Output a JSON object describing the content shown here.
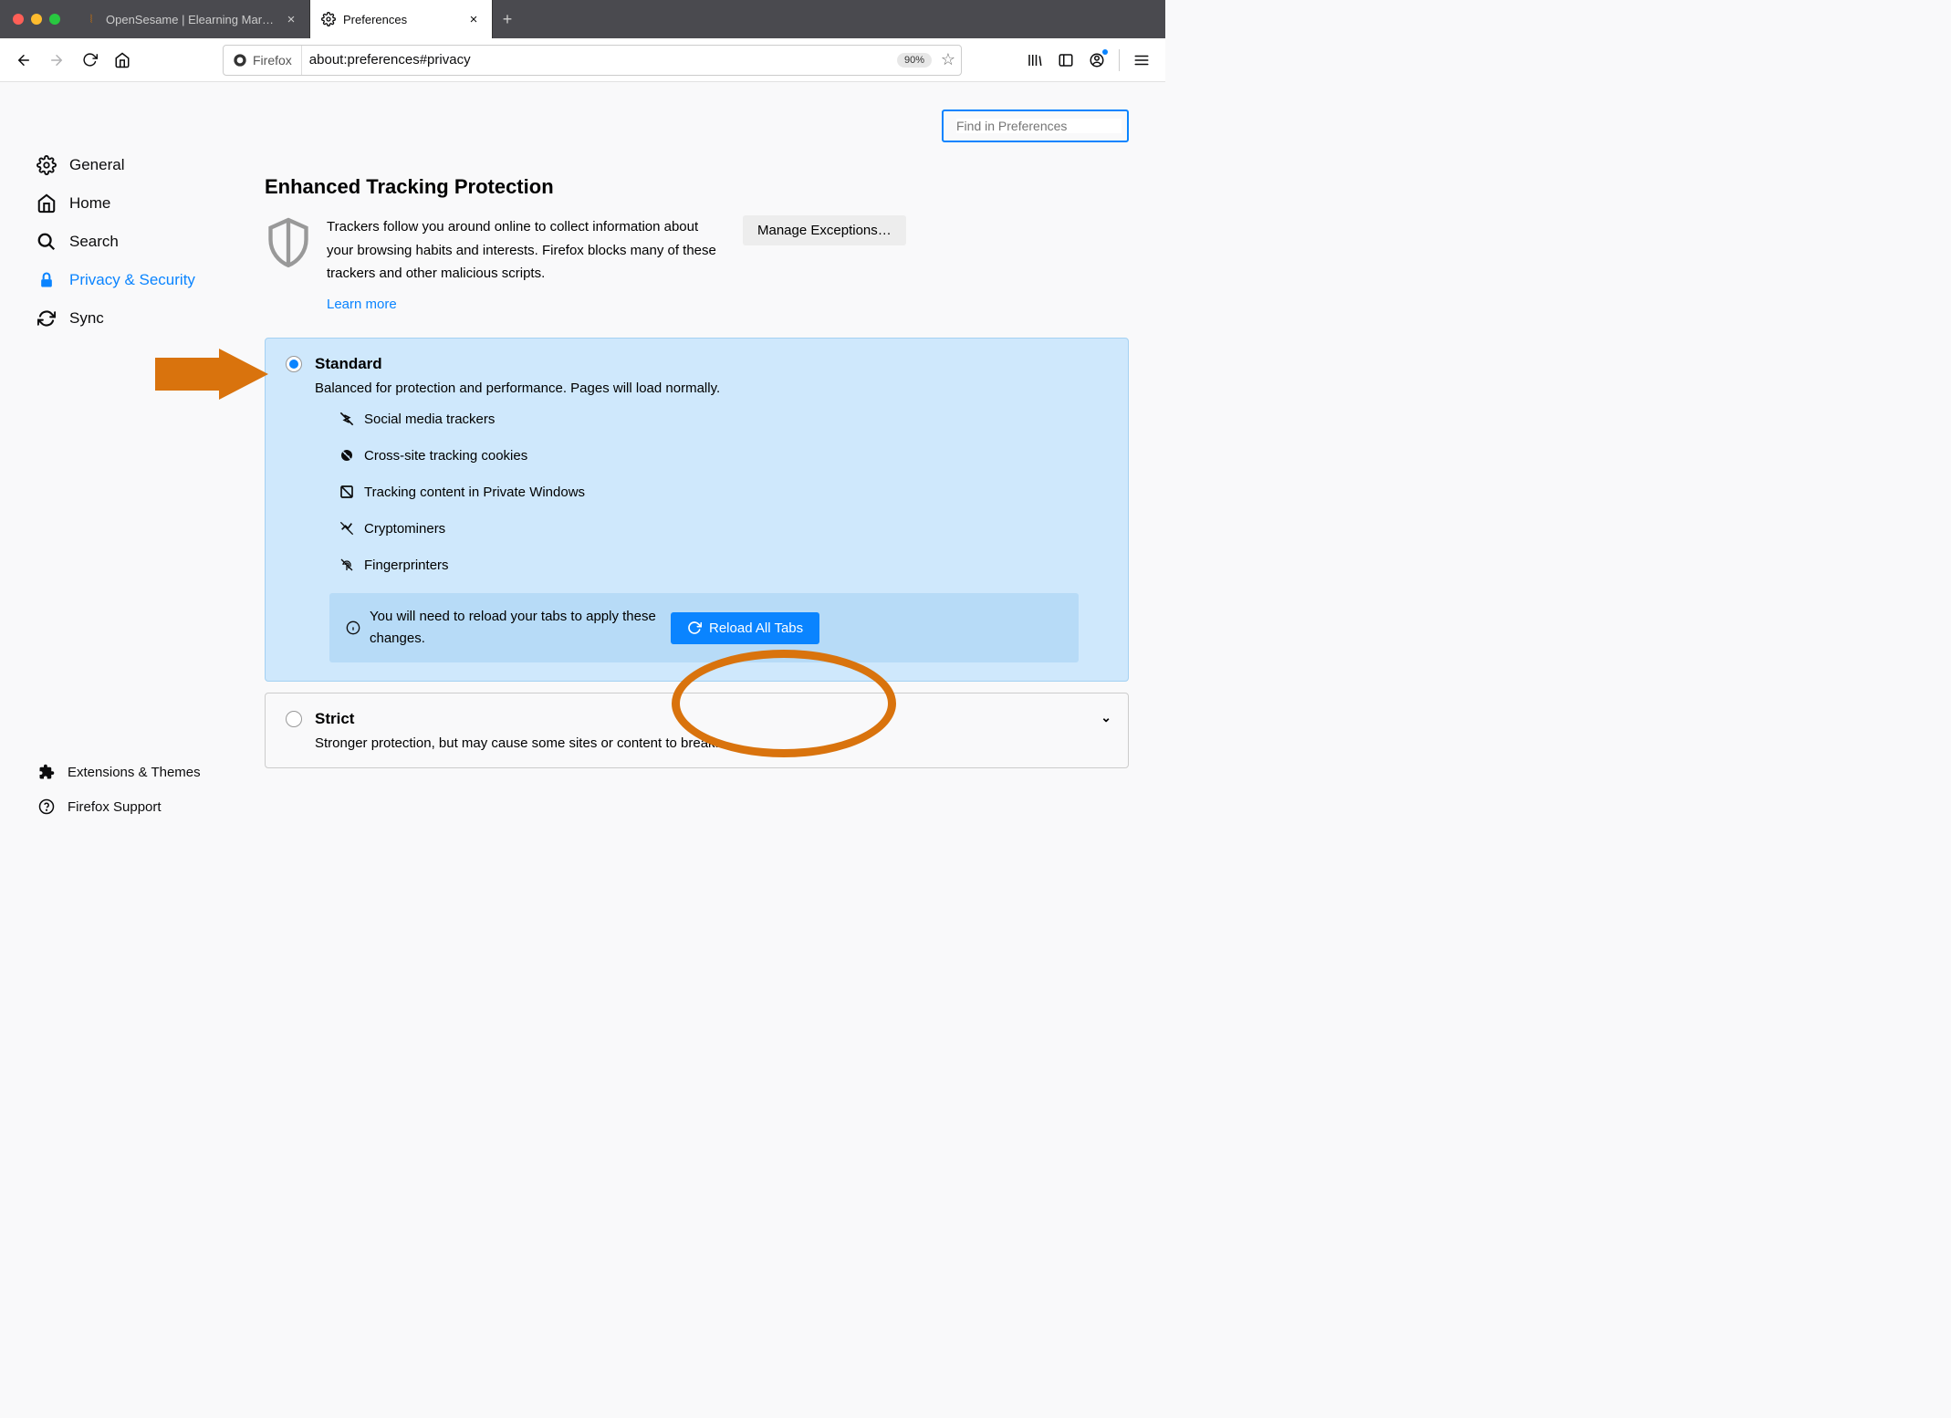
{
  "tabs": [
    {
      "title": "OpenSesame | Elearning Marketplace"
    },
    {
      "title": "Preferences"
    }
  ],
  "urlbar": {
    "identity": "Firefox",
    "url": "about:preferences#privacy",
    "zoom": "90%"
  },
  "sidebar": {
    "items": [
      {
        "label": "General"
      },
      {
        "label": "Home"
      },
      {
        "label": "Search"
      },
      {
        "label": "Privacy & Security"
      },
      {
        "label": "Sync"
      }
    ],
    "bottom": [
      {
        "label": "Extensions & Themes"
      },
      {
        "label": "Firefox Support"
      }
    ]
  },
  "search": {
    "placeholder": "Find in Preferences"
  },
  "etp": {
    "title": "Enhanced Tracking Protection",
    "desc": "Trackers follow you around online to collect information about your browsing habits and interests. Firefox blocks many of these trackers and other malicious scripts.",
    "learn": "Learn more",
    "manage": "Manage Exceptions…"
  },
  "option_standard": {
    "title": "Standard",
    "sub": "Balanced for protection and performance. Pages will load normally.",
    "items": [
      "Social media trackers",
      "Cross-site tracking cookies",
      "Tracking content in Private Windows",
      "Cryptominers",
      "Fingerprinters"
    ],
    "reload_msg": "You will need to reload your tabs to apply these changes.",
    "reload_btn": "Reload All Tabs"
  },
  "option_strict": {
    "title": "Strict",
    "sub": "Stronger protection, but may cause some sites or content to break."
  }
}
